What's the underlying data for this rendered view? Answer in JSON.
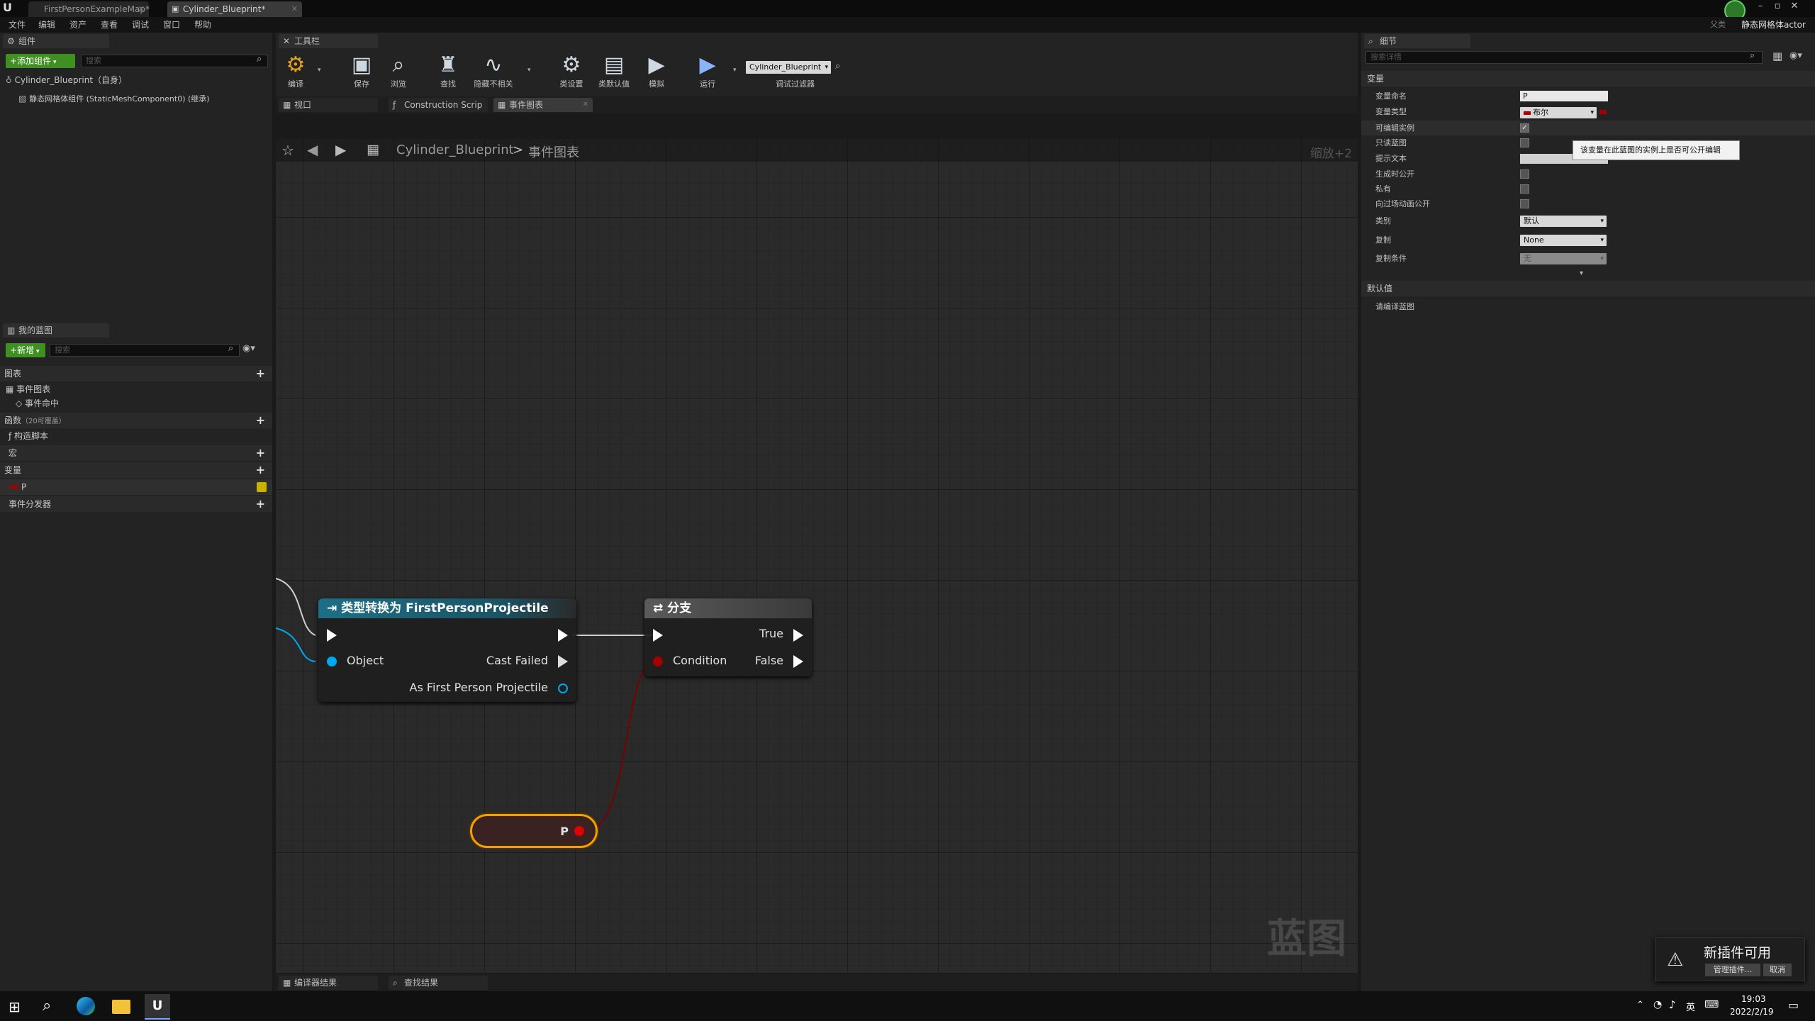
{
  "titlebar": {
    "tabs": [
      {
        "label": "FirstPersonExampleMap*"
      },
      {
        "label": "Cylinder_Blueprint*"
      }
    ],
    "right_label": "静态网格体actor",
    "parent_label": "父类"
  },
  "menu": [
    "文件",
    "编辑",
    "资产",
    "查看",
    "调试",
    "窗口",
    "帮助"
  ],
  "components_panel": {
    "tab_label": "组件",
    "add_button": "添加组件",
    "search_placeholder": "搜索",
    "tree": [
      {
        "label": "Cylinder_Blueprint（自身）"
      },
      {
        "label": "静态网格体组件 (StaticMeshComponent0) (继承)"
      }
    ]
  },
  "my_blueprint": {
    "tab_label": "我的蓝图",
    "new_button": "新增",
    "search_placeholder": "搜索",
    "sections": [
      {
        "label": "图表"
      },
      {
        "label": "事件图表"
      },
      {
        "label": "事件命中"
      },
      {
        "label": "函数",
        "note": "（20可覆盖）"
      },
      {
        "label": "构造脚本"
      },
      {
        "label": "宏"
      },
      {
        "label": "变量"
      },
      {
        "label": "P"
      },
      {
        "label": "事件分发器"
      }
    ]
  },
  "toolbar": {
    "tab_label": "工具栏",
    "buttons": [
      "编译",
      "保存",
      "浏览",
      "查找",
      "隐藏不相关",
      "类设置",
      "类默认值",
      "模拟",
      "运行"
    ],
    "debug_object": "Cylinder_Blueprint",
    "debug_filter_label": "调试过滤器"
  },
  "editor_tabs": [
    {
      "label": "视口"
    },
    {
      "label": "Construction Scrip"
    },
    {
      "label": "事件图表"
    }
  ],
  "graph": {
    "breadcrumb_root": "Cylinder_Blueprint",
    "breadcrumb_sep": ">",
    "breadcrumb_leaf": "事件图表",
    "zoom": "缩放+2",
    "watermark": "蓝图",
    "cast_node": {
      "title": "类型转换为 FirstPersonProjectile",
      "object_pin": "Object",
      "cast_failed_pin": "Cast Failed",
      "as_pin": "As First Person Projectile"
    },
    "branch_node": {
      "title": "分支",
      "condition_pin": "Condition",
      "true_pin": "True",
      "false_pin": "False"
    },
    "variable_node": {
      "label": "P"
    }
  },
  "bottom_tabs": [
    {
      "label": "编译器结果"
    },
    {
      "label": "查找结果"
    }
  ],
  "details": {
    "tab_label": "细节",
    "search_placeholder": "搜索详情",
    "variable_section": "变量",
    "props": {
      "name_label": "变量命名",
      "name_value": "P",
      "type_label": "变量类型",
      "type_value": "布尔",
      "editable_label": "可编辑实例",
      "readonly_label": "只读蓝图",
      "tooltip_label": "提示文本",
      "expose_spawn_label": "生成时公开",
      "private_label": "私有",
      "expose_cine_label": "向过场动画公开",
      "category_label": "类别",
      "category_value": "默认",
      "replication_label": "复制",
      "replication_value": "None",
      "rep_cond_label": "复制条件",
      "rep_cond_value": "无"
    },
    "tooltip_popup": "该变量在此蓝图的实例上是否可公开编辑",
    "default_section": "默认值",
    "compile_hint": "请编译蓝图"
  },
  "notification": {
    "title": "新插件可用",
    "manage_button": "管理插件...",
    "cancel_button": "取消"
  },
  "taskbar": {
    "time": "19:03",
    "date": "2022/2/19",
    "ime": "英"
  },
  "colors": {
    "exec": "#ffffff",
    "bool_pin": "#a50000",
    "object_pin": "#00a8f3",
    "cast_header": "#1d6f85",
    "accent_green": "#3f8f22"
  }
}
